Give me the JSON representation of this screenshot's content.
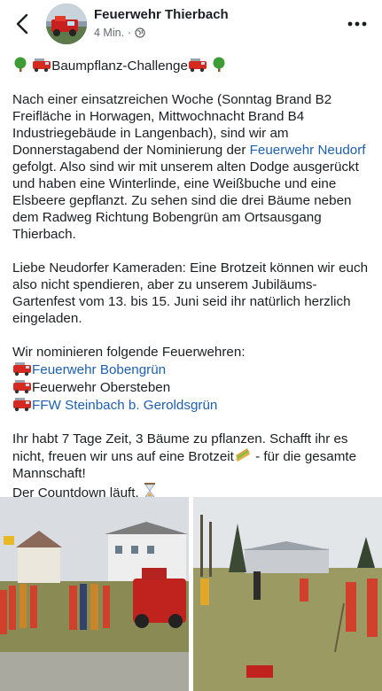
{
  "header": {
    "page_name": "Feuerwehr Thierbach",
    "time": "4 Min.",
    "separator": "·",
    "icons": {
      "back": "back-chevron-icon",
      "privacy": "globe-icon",
      "more": "more-dots-icon"
    }
  },
  "post": {
    "title": "Baumpflanz-Challenge",
    "p1_text": "Nach einer einsatzreichen Woche (Sonntag Brand B2 Freifläche in Horwagen, Mittwochnacht Brand B4 Industriegebäude in Langenbach), sind wir am Donnerstagabend der Nominierung der ",
    "p1_link": "Feuerwehr Neudorf",
    "p1_rest": " gefolgt. Also sind wir mit unserem alten Dodge ausgerückt und haben eine Winterlinde, eine Weißbuche und eine Elsbeere gepflanzt. Zu sehen sind die drei Bäume neben dem Radweg Richtung Bobengrün am Ortsausgang Thierbach.",
    "p2": "Liebe Neudorfer Kameraden: Eine Brotzeit können wir euch also nicht spendieren, aber zu unserem Jubiläums-Gartenfest vom 13. bis 15. Juni seid ihr natürlich herzlich eingeladen.",
    "nominate_intro": "Wir nominieren folgende Feuerwehren:",
    "nominees": [
      "Feuerwehr Bobengrün",
      "Feuerwehr Obersteben",
      "FFW Steinbach b. Geroldsgrün"
    ],
    "p4a": "Ihr habt 7 Tage Zeit, 3 Bäume zu pflanzen. Schafft ihr es nicht, freuen wir uns auf eine Brotzeit",
    "p4b": " - für die gesamte Mannschaft!",
    "p4c": "Der Countdown läuft. ",
    "colors": {
      "link": "#1d5fb1",
      "text": "#1c1e21",
      "meta": "#65676b"
    }
  }
}
